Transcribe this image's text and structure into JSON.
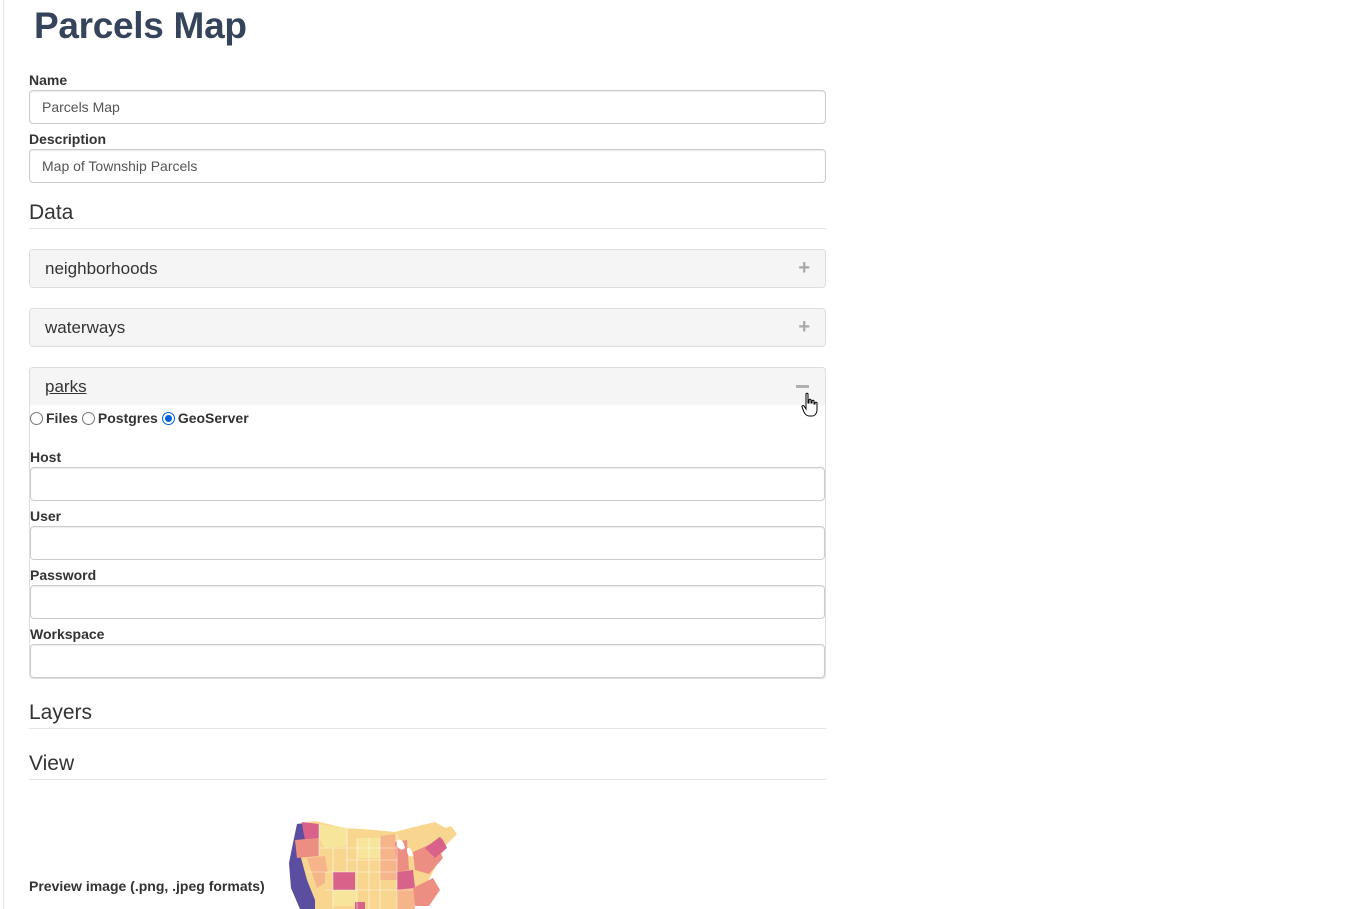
{
  "page": {
    "title": "Parcels Map"
  },
  "form": {
    "name_label": "Name",
    "name_value": "Parcels Map",
    "description_label": "Description",
    "description_value": "Map of Township Parcels"
  },
  "data_section": {
    "heading": "Data",
    "panels": [
      {
        "title": "neighborhoods",
        "state": "collapsed",
        "icon": "plus-icon"
      },
      {
        "title": "waterways",
        "state": "collapsed",
        "icon": "plus-icon"
      },
      {
        "title": "parks",
        "state": "expanded",
        "icon": "minus-icon"
      }
    ],
    "source_options": [
      {
        "label": "Files",
        "checked": false
      },
      {
        "label": "Postgres",
        "checked": false
      },
      {
        "label": "GeoServer",
        "checked": true
      }
    ],
    "geoserver_fields": {
      "host_label": "Host",
      "host_value": "",
      "user_label": "User",
      "user_value": "",
      "password_label": "Password",
      "password_value": "",
      "workspace_label": "Workspace",
      "workspace_value": ""
    }
  },
  "layers_section": {
    "heading": "Layers"
  },
  "view_section": {
    "heading": "View",
    "preview_label": "Preview image (.png, .jpeg formats)"
  },
  "colors": {
    "title": "#35445a",
    "panel_heading_bg": "#f5f5f5",
    "radio_checked": "#0060df",
    "map_palette": [
      "#5b4ea0",
      "#d9628a",
      "#ec8f82",
      "#f5b489",
      "#f8d68f",
      "#f6e59a"
    ]
  }
}
